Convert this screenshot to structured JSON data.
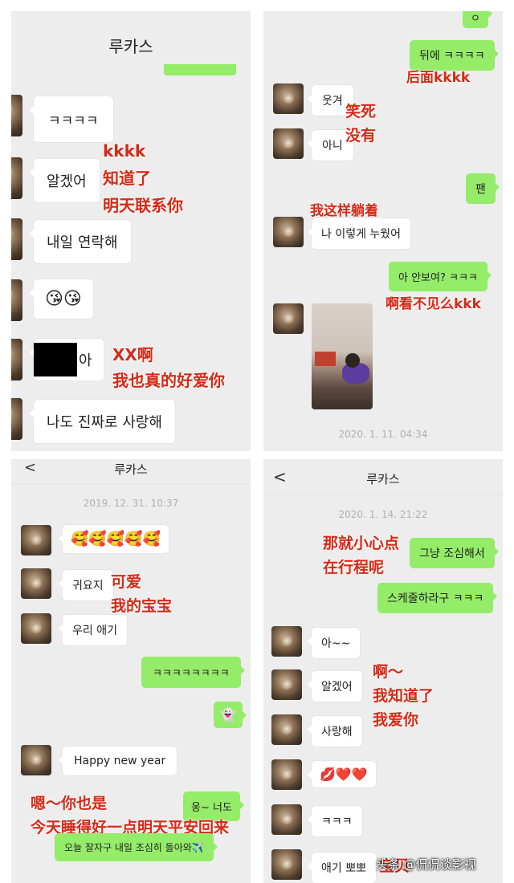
{
  "p1": {
    "title": "루카스",
    "messages": [
      "ㅋㅋㅋㅋ",
      "알겠어",
      "내일 연락해",
      "😘😘",
      "아",
      "나도 진짜로 사랑해"
    ],
    "notes": [
      "kkkk",
      "知道了",
      "明天联系你",
      "XX啊",
      "我也真的好爱你"
    ]
  },
  "p2": {
    "msg_top_partial": "ㅇ",
    "msg_right_1": "뒤에 ㅋㅋㅋㅋ",
    "note_1": "后面kkkk",
    "msg_left_1": "웃겨",
    "note_2": "笑死",
    "msg_left_2": "아니",
    "note_3": "没有",
    "msg_right_2": "팬",
    "note_4": "我这样躺着",
    "msg_left_3": "나 이렇게 누웠어",
    "msg_right_3": "아 안보여? ㅋㅋㅋ",
    "note_5": "啊看不见么kkk",
    "timestamp": "2020. 1. 11. 04:34"
  },
  "p3": {
    "back": "<",
    "title": "루카스",
    "timestamp": "2019. 12. 31. 10:37",
    "msg_emoji": "🥰🥰🥰🥰🥰",
    "msg_1": "귀요지",
    "note_1": "可爱",
    "note_2": "我的宝宝",
    "msg_2": "우리 애기",
    "msg_right_1": "ㅋㅋㅋㅋㅋㅋㅋㅋ",
    "msg_right_ghost": "👻",
    "msg_3": "Happy new year",
    "note_3": "嗯～你也是",
    "msg_right_2": "웅~ 너도",
    "note_4": "今天睡得好一点明天平安回来",
    "msg_right_3": "오늘 잘자구 내일 조심히 돌아와✈️"
  },
  "p4": {
    "back": "<",
    "title": "루카스",
    "timestamp": "2020. 1. 14. 21:22",
    "note_1": "那就小心点",
    "note_2": "在行程呢",
    "msg_right_1": "그냥 조심해서",
    "msg_right_2": "스케줄하라구 ㅋㅋㅋ",
    "msg_1": "아~~",
    "msg_2": "알겠어",
    "note_3": "啊～",
    "note_4": "我知道了",
    "note_5": "我爱你",
    "msg_3": "사랑해",
    "msg_4": "💋❤️❤️",
    "msg_5": "ㅋㅋㅋ",
    "msg_6": "애기 뽀뽀",
    "note_6": "宝贝"
  },
  "watermark": "头条 @侃侃谈影视"
}
